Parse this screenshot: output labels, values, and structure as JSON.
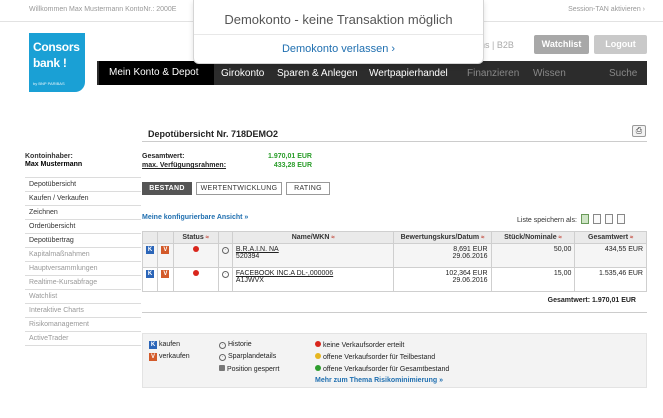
{
  "topbar": {
    "welcome": "Willkommen Max Mustermann   KontoNr.: 2000E",
    "session_tan": "Session-TAN aktivieren ›"
  },
  "logo": {
    "line1": "Consors",
    "line2": "bank !",
    "line3": "by BNP PARIBAS"
  },
  "header": {
    "links": "ns | B2B",
    "watchlist_label": "Watchlist",
    "logout_label": "Logout"
  },
  "nav": {
    "active": "Mein Konto & Depot",
    "items": [
      "Girokonto",
      "Sparen & Anlegen",
      "Wertpapierhandel",
      "Finanzieren",
      "Wissen"
    ],
    "search": "Suche"
  },
  "overlay": {
    "message": "Demokonto - keine Transaktion möglich",
    "leave": "Demokonto verlassen ›"
  },
  "sidebar": {
    "header": "Kontoinhaber:",
    "name": "Max Mustermann",
    "items": [
      {
        "label": "Depotübersicht",
        "dim": false
      },
      {
        "label": "Kaufen / Verkaufen",
        "dim": false
      },
      {
        "label": "Zeichnen",
        "dim": false
      },
      {
        "label": "Orderübersicht",
        "dim": false
      },
      {
        "label": "Depotübertrag",
        "dim": false
      },
      {
        "label": "Kapitalmaßnahmen",
        "dim": true
      },
      {
        "label": "Hauptversammlungen",
        "dim": true
      },
      {
        "label": "Realtime-Kursabfrage",
        "dim": true
      },
      {
        "label": "Watchlist",
        "dim": true
      },
      {
        "label": "Interaktive Charts",
        "dim": true
      },
      {
        "label": "Risikomanagement",
        "dim": true
      },
      {
        "label": "ActiveTrader",
        "dim": true
      }
    ]
  },
  "main": {
    "title": "Depotübersicht Nr. 718DEMO2",
    "gesamtwert_label": "Gesamtwert:",
    "gesamtwert_value": "1.970,01 EUR",
    "rahmen_label": "max. Verfügungsrahmen:",
    "rahmen_value": "433,28 EUR",
    "tabs": [
      "BESTAND",
      "WERTENTWICKLUNG",
      "RATING"
    ],
    "konfig_link": "Meine konfigurierbare Ansicht »",
    "liste_label": "Liste speichern als:",
    "columns": {
      "status": "Status",
      "name": "Name/WKN",
      "kurs": "Bewertungskurs/Datum",
      "stueck": "Stück/Nominale",
      "gesamt": "Gesamtwert"
    },
    "rows": [
      {
        "name": "B.R.A.I.N. NA",
        "wkn": "520394",
        "kurs": "8,691 EUR",
        "datum": "29.06.2016",
        "stueck": "50,00",
        "gesamt": "434,55 EUR"
      },
      {
        "name": "FACEBOOK INC.A DL-,000006",
        "wkn": "A1JWVX",
        "kurs": "102,364 EUR",
        "datum": "29.06.2016",
        "stueck": "15,00",
        "gesamt": "1.535,46 EUR"
      }
    ],
    "gesamt_footer": "Gesamtwert: 1.970,01 EUR"
  },
  "legend": {
    "kaufen": "kaufen",
    "verkaufen": "verkaufen",
    "historie": "Historie",
    "sparplan": "Sparplandetails",
    "gesperrt": "Position gesperrt",
    "keine": "keine Verkaufsorder erteilt",
    "teil": "offene Verkaufsorder für Teilbestand",
    "gesamt": "offene Verkaufsorder für Gesamtbestand",
    "risiko": "Mehr zum Thema Risikominimierung »"
  }
}
